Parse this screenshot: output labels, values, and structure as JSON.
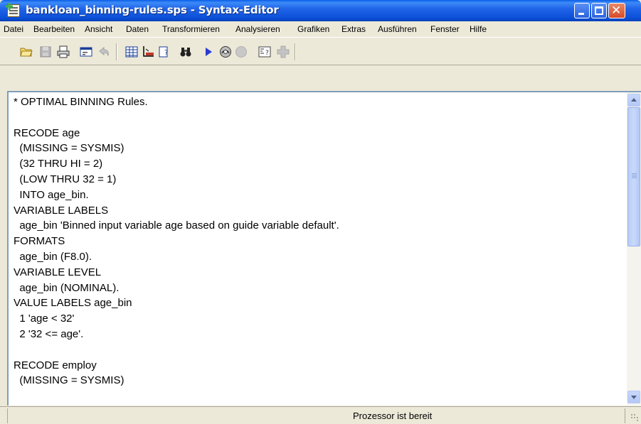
{
  "window": {
    "title": "bankloan_binning-rules.sps - Syntax-Editor"
  },
  "menu": [
    "Datei",
    "Bearbeiten",
    "Ansicht",
    "Daten",
    "Transformieren",
    "Analysieren",
    "Grafiken",
    "Extras",
    "Ausführen",
    "Fenster",
    "Hilfe"
  ],
  "toolbar": {
    "icons": [
      "open-folder-icon",
      "save-icon",
      "print-icon",
      "dialog-recall-icon",
      "undo-icon",
      "goto-data-icon",
      "goto-case-icon",
      "variables-info-icon",
      "find-icon",
      "run-icon",
      "spss-icon-disabled",
      "stop-icon-disabled",
      "syntax-help-icon",
      "add-icon-disabled"
    ]
  },
  "editor": {
    "lines": [
      "* OPTIMAL BINNING Rules.",
      "",
      "RECODE age",
      "  (MISSING = SYSMIS)",
      "  (32 THRU HI = 2)",
      "  (LOW THRU 32 = 1)",
      "  INTO age_bin.",
      "VARIABLE LABELS",
      "  age_bin 'Binned input variable age based on guide variable default'.",
      "FORMATS",
      "  age_bin (F8.0).",
      "VARIABLE LEVEL",
      "  age_bin (NOMINAL).",
      "VALUE LABELS age_bin",
      "  1 'age < 32'",
      "  2 '32 <= age'.",
      "",
      "RECODE employ",
      "  (MISSING = SYSMIS)"
    ]
  },
  "status": {
    "text": "Prozessor ist bereit"
  },
  "colors": {
    "titlebar": "#0a4fd6",
    "chrome": "#ece9d8",
    "editor_bg": "#ffffff"
  }
}
